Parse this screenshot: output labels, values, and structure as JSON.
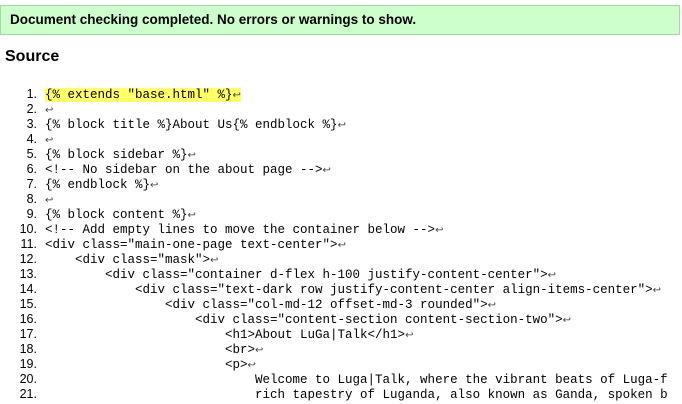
{
  "status": {
    "message": "Document checking completed. No errors or warnings to show."
  },
  "source": {
    "heading": "Source",
    "eol_mark": "↩",
    "lines": [
      {
        "n": "1.",
        "code": "{% extends \"base.html\" %}",
        "highlight": true
      },
      {
        "n": "2.",
        "code": ""
      },
      {
        "n": "3.",
        "code": "{% block title %}About Us{% endblock %}"
      },
      {
        "n": "4.",
        "code": ""
      },
      {
        "n": "5.",
        "code": "{% block sidebar %}"
      },
      {
        "n": "6.",
        "code": "<!-- No sidebar on the about page -->"
      },
      {
        "n": "7.",
        "code": "{% endblock %}"
      },
      {
        "n": "8.",
        "code": ""
      },
      {
        "n": "9.",
        "code": "{% block content %}"
      },
      {
        "n": "10.",
        "code": "<!-- Add empty lines to move the container below -->"
      },
      {
        "n": "11.",
        "code": "<div class=\"main-one-page text-center\">"
      },
      {
        "n": "12.",
        "code": "    <div class=\"mask\">"
      },
      {
        "n": "13.",
        "code": "        <div class=\"container d-flex h-100 justify-content-center\">"
      },
      {
        "n": "14.",
        "code": "            <div class=\"text-dark row justify-content-center align-items-center\">"
      },
      {
        "n": "15.",
        "code": "                <div class=\"col-md-12 offset-md-3 rounded\">"
      },
      {
        "n": "16.",
        "code": "                    <div class=\"content-section content-section-two\">"
      },
      {
        "n": "17.",
        "code": "                        <h1>About LuGa|Talk</h1>"
      },
      {
        "n": "18.",
        "code": "                        <br>"
      },
      {
        "n": "19.",
        "code": "                        <p>"
      },
      {
        "n": "20.",
        "code": "                            Welcome to Luga|Talk, where the vibrant beats of Luga-f",
        "noeol": true
      },
      {
        "n": "21.",
        "code": "                            rich tapestry of Luganda, also known as Ganda, spoken b",
        "noeol": true
      }
    ]
  }
}
